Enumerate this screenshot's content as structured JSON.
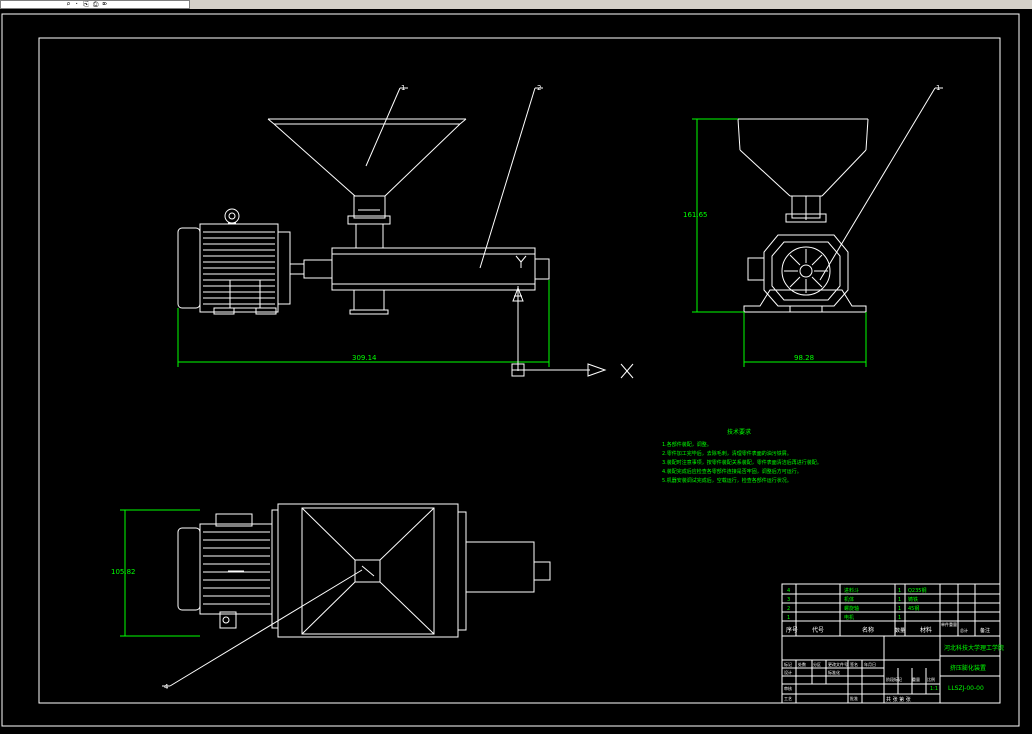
{
  "window": {
    "address_text": "               ⌕ · ⎘ ⎙ ⌦"
  },
  "drawing": {
    "dimensions": {
      "overall_length": "309.14",
      "height": "161.65",
      "width_front": "98.28",
      "width_top": "105.82"
    },
    "balloons": {
      "b1": "1",
      "b2": "2",
      "b3": "1",
      "b4": "4"
    },
    "axes": {
      "x": "X",
      "y": "Y"
    },
    "notes": {
      "title": "技术要求",
      "lines": [
        "1.各部件装配，调整。",
        "2.零件加工完毕后，去除毛刺，清理零件表面的油污铁屑。",
        "3.装配时注意事项，按零件装配关系装配，零件表面清洁后再进行装配。",
        "4.装配完成后应检查各零部件连接是否牢固，调整后方可运行。",
        "5.机器安装调试完成后，空载运行，检查各部件运行状况。"
      ]
    },
    "parts": [
      {
        "no": "4",
        "code": "",
        "name": "进料斗",
        "qty": "1",
        "material": "Q235钢"
      },
      {
        "no": "3",
        "code": "",
        "name": "机体",
        "qty": "1",
        "material": "铸铁"
      },
      {
        "no": "2",
        "code": "",
        "name": "螺旋轴",
        "qty": "1",
        "material": "45钢"
      },
      {
        "no": "1",
        "code": "",
        "name": "电机",
        "qty": "1",
        "material": ""
      }
    ],
    "parts_header": {
      "no": "序号",
      "code": "代号",
      "name": "名称",
      "qty": "数量",
      "material": "材料",
      "weight": "单件重量",
      "total": "总计",
      "remark": "备注"
    },
    "title_block": {
      "school": "河北科技大学理工学院",
      "drawing_name": "挤压膨化装置",
      "drawing_code": "LLSZJ-00-00",
      "scale": "1:1",
      "sheet": "共 张  第 张",
      "labels": [
        "标记",
        "处数",
        "分区",
        "更改文件号",
        "签名",
        "年月日"
      ],
      "row2": [
        "设计",
        "标准化",
        "阶段标记",
        "重量",
        "比例"
      ],
      "row3": [
        "审核",
        "",
        "",
        ""
      ],
      "row4": [
        "工艺",
        "批准"
      ]
    }
  }
}
